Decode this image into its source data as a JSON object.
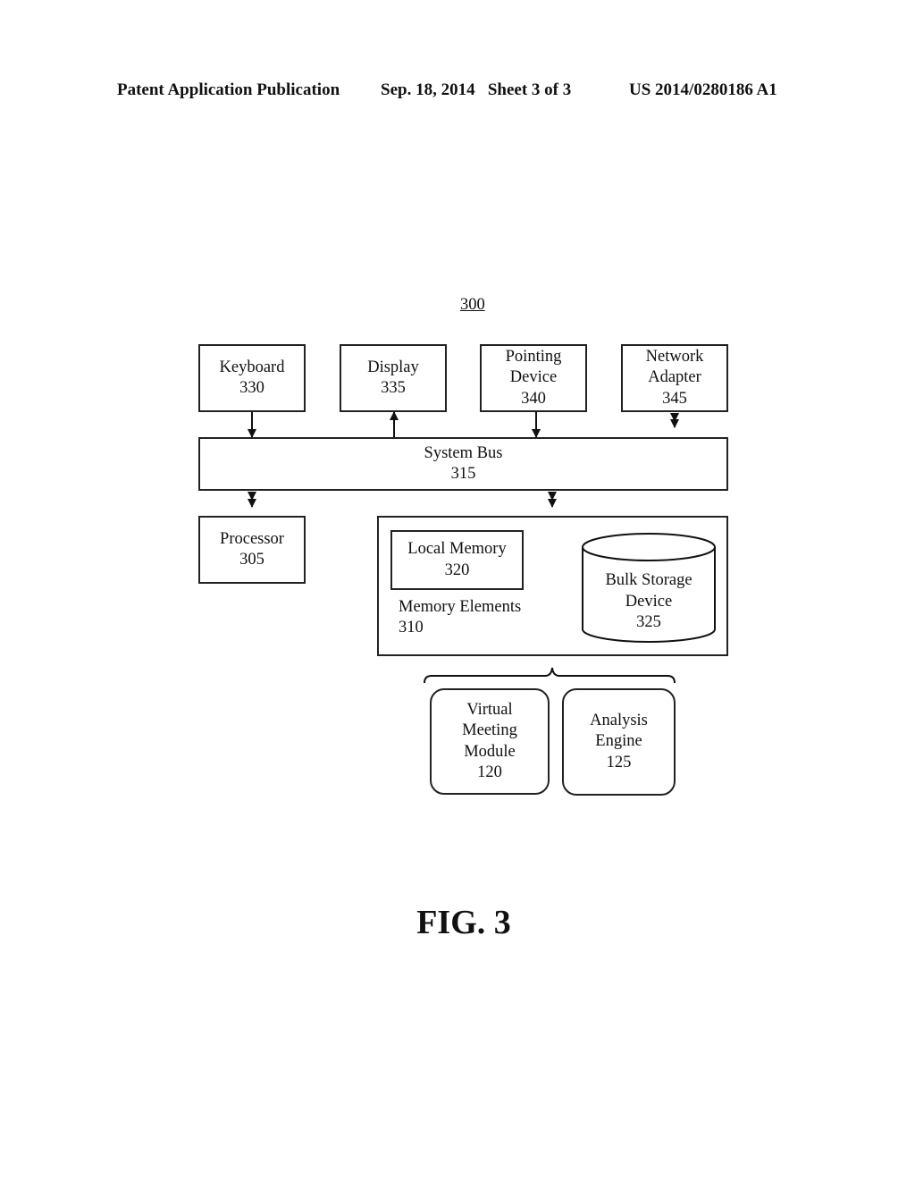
{
  "header": {
    "left": "Patent Application Publication",
    "middle": "Sep. 18, 2014   Sheet 3 of 3",
    "right": "US 2014/0280186 A1"
  },
  "figure_ref": "300",
  "blocks": {
    "keyboard": {
      "name": "Keyboard",
      "num": "330"
    },
    "display": {
      "name": "Display",
      "num": "335"
    },
    "pointing": {
      "name1": "Pointing",
      "name2": "Device",
      "num": "340"
    },
    "network": {
      "name1": "Network",
      "name2": "Adapter",
      "num": "345"
    },
    "bus": {
      "name": "System Bus",
      "num": "315"
    },
    "processor": {
      "name": "Processor",
      "num": "305"
    },
    "local_memory": {
      "name": "Local Memory",
      "num": "320"
    },
    "memory_elements": {
      "name": "Memory Elements",
      "num": "310"
    },
    "bulk_storage": {
      "name1": "Bulk Storage",
      "name2": "Device",
      "num": "325"
    },
    "virtual_meeting": {
      "name1": "Virtual",
      "name2": "Meeting",
      "name3": "Module",
      "num": "120"
    },
    "analysis": {
      "name1": "Analysis",
      "name2": "Engine",
      "num": "125"
    }
  },
  "caption": "FIG. 3"
}
